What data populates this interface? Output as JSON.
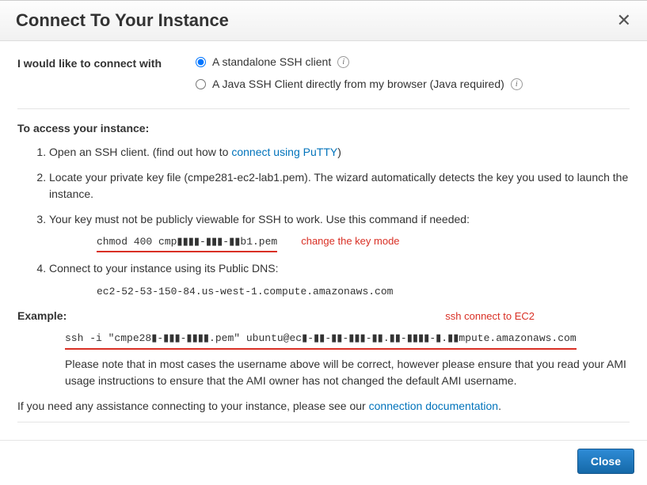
{
  "header": {
    "title": "Connect To Your Instance"
  },
  "connect": {
    "label": "I would like to connect with",
    "opt1": "A standalone SSH client",
    "opt2": "A Java SSH Client directly from my browser (Java required)"
  },
  "access_heading": "To access your instance:",
  "steps": {
    "s1_a": "Open an SSH client. (find out how to ",
    "s1_link": "connect using PuTTY",
    "s1_b": ")",
    "s2": "Locate your private key file (cmpe281-ec2-lab1.pem). The wizard automatically detects the key you used to launch the instance.",
    "s3": "Your key must not be publicly viewable for SSH to work. Use this command if needed:",
    "s3_cmd": "chmod 400 cmp▮▮▮▮-▮▮▮-▮▮b1.pem",
    "s3_annot": "change the key mode",
    "s4": "Connect to your instance using its Public DNS:",
    "s4_dns": "ec2-52-53-150-84.us-west-1.compute.amazonaws.com"
  },
  "example": {
    "label": "Example:",
    "annot": "ssh connect to EC2",
    "cmd": "ssh -i \"cmpe28▮-▮▮▮-▮▮▮▮.pem\" ubuntu@ec▮-▮▮-▮▮-▮▮▮-▮▮.▮▮-▮▮▮▮-▮.▮▮mpute.amazonaws.com",
    "note": "Please note that in most cases the username above will be correct, however please ensure that you read your AMI usage instructions to ensure that the AMI owner has not changed the default AMI username."
  },
  "assist": {
    "a": "If you need any assistance connecting to your instance, please see our ",
    "link": "connection documentation",
    "b": "."
  },
  "footer": {
    "close": "Close"
  }
}
